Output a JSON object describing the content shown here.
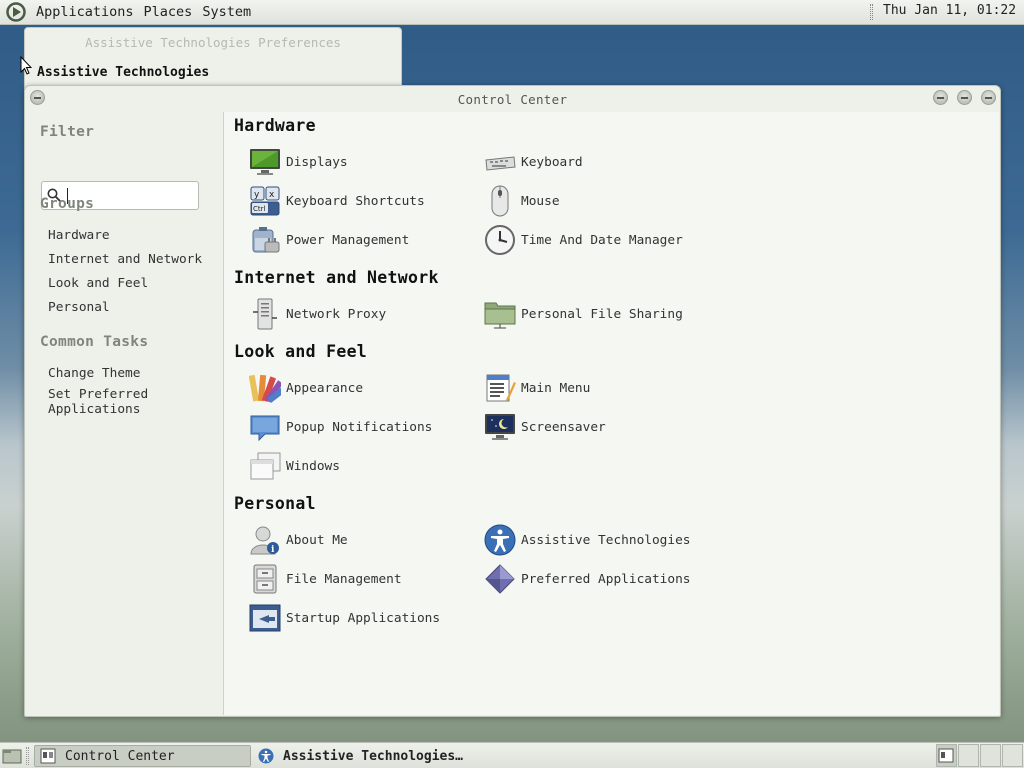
{
  "top_panel": {
    "menus": [
      "Applications",
      "Places",
      "System"
    ],
    "clock": "Thu Jan 11, 01:22"
  },
  "bg_dialog": {
    "title": "Assistive Technologies Preferences",
    "subtitle": "Assistive Technologies"
  },
  "window": {
    "title": "Control Center"
  },
  "sidebar": {
    "filter_heading": "Filter",
    "search_value": "",
    "groups_heading": "Groups",
    "groups": [
      "Hardware",
      "Internet and Network",
      "Look and Feel",
      "Personal"
    ],
    "tasks_heading": "Common Tasks",
    "tasks": [
      "Change Theme",
      "Set Preferred\nApplications"
    ]
  },
  "categories": [
    {
      "name": "Hardware",
      "items": [
        {
          "label": "Displays",
          "icon": "display-icon"
        },
        {
          "label": "Keyboard",
          "icon": "keyboard-icon"
        },
        {
          "label": "Keyboard Shortcuts",
          "icon": "keyboard-shortcuts-icon"
        },
        {
          "label": "Mouse",
          "icon": "mouse-icon"
        },
        {
          "label": "Power Management",
          "icon": "power-icon"
        },
        {
          "label": "Time And Date Manager",
          "icon": "clock-icon"
        }
      ]
    },
    {
      "name": "Internet and Network",
      "items": [
        {
          "label": "Network Proxy",
          "icon": "network-proxy-icon"
        },
        {
          "label": "Personal File Sharing",
          "icon": "folder-share-icon"
        }
      ]
    },
    {
      "name": "Look and Feel",
      "items": [
        {
          "label": "Appearance",
          "icon": "appearance-icon"
        },
        {
          "label": "Main Menu",
          "icon": "main-menu-icon"
        },
        {
          "label": "Popup Notifications",
          "icon": "notification-icon"
        },
        {
          "label": "Screensaver",
          "icon": "screensaver-icon"
        },
        {
          "label": "Windows",
          "icon": "windows-icon"
        }
      ]
    },
    {
      "name": "Personal",
      "items": [
        {
          "label": "About Me",
          "icon": "about-me-icon"
        },
        {
          "label": "Assistive Technologies",
          "icon": "accessibility-icon"
        },
        {
          "label": "File Management",
          "icon": "file-management-icon"
        },
        {
          "label": "Preferred Applications",
          "icon": "preferred-apps-icon"
        },
        {
          "label": "Startup Applications",
          "icon": "startup-icon"
        }
      ]
    }
  ],
  "taskbar": {
    "tasks": [
      {
        "label": "Control Center",
        "active": true
      },
      {
        "label": "Assistive Technologies…",
        "active": false
      }
    ]
  }
}
